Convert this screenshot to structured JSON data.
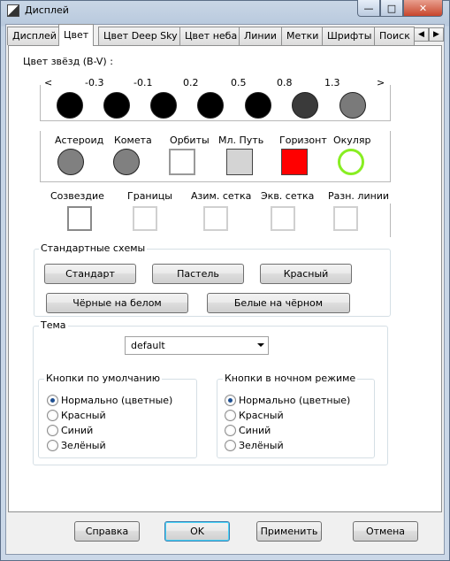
{
  "window": {
    "title": "Дисплей"
  },
  "tabs": [
    {
      "label": "Дисплей",
      "active": false
    },
    {
      "label": "Цвет",
      "active": true
    },
    {
      "label": "Цвет Deep Sky",
      "active": false
    },
    {
      "label": "Цвет неба",
      "active": false
    },
    {
      "label": "Линии",
      "active": false
    },
    {
      "label": "Метки",
      "active": false
    },
    {
      "label": "Шрифты",
      "active": false
    },
    {
      "label": "Поиск",
      "active": false
    }
  ],
  "star_colors": {
    "label": "Цвет звёзд (B-V) :",
    "left_marker": "<",
    "right_marker": ">",
    "ticks": [
      "-0.3",
      "-0.1",
      "0.2",
      "0.5",
      "0.8",
      "1.3"
    ],
    "swatches": [
      "#000000",
      "#000000",
      "#000000",
      "#000000",
      "#000000",
      "#3a3a3a",
      "#7a7a7a"
    ]
  },
  "objects": [
    {
      "label": "Астероид",
      "shape": "circle",
      "color": "#808080"
    },
    {
      "label": "Комета",
      "shape": "circle",
      "color": "#808080"
    },
    {
      "label": "Орбиты",
      "shape": "square",
      "color": "#ffffff"
    },
    {
      "label": "Мл. Путь",
      "shape": "square",
      "color": "#d4d4d4"
    },
    {
      "label": "Горизонт",
      "shape": "square",
      "color": "#ff0000"
    },
    {
      "label": "Окуляр",
      "shape": "ring",
      "color": "#88ee22"
    }
  ],
  "lines": [
    {
      "label": "Созвездие"
    },
    {
      "label": "Границы"
    },
    {
      "label": "Азим. сетка"
    },
    {
      "label": "Экв. сетка"
    },
    {
      "label": "Разн. линии"
    }
  ],
  "schemes": {
    "title": "Стандартные схемы",
    "buttons": [
      "Стандарт",
      "Пастель",
      "Красный",
      "Чёрные на белом",
      "Белые на чёрном"
    ]
  },
  "theme": {
    "title": "Тема",
    "selected": "default",
    "default_buttons": {
      "title": "Кнопки по умолчанию",
      "options": [
        "Нормально (цветные)",
        "Красный",
        "Синий",
        "Зелёный"
      ],
      "selected_index": 0
    },
    "night_buttons": {
      "title": "Кнопки в ночном режиме",
      "options": [
        "Нормально (цветные)",
        "Красный",
        "Синий",
        "Зелёный"
      ],
      "selected_index": 0
    }
  },
  "footer": {
    "help": "Справка",
    "ok": "OK",
    "apply": "Применить",
    "cancel": "Отмена"
  }
}
